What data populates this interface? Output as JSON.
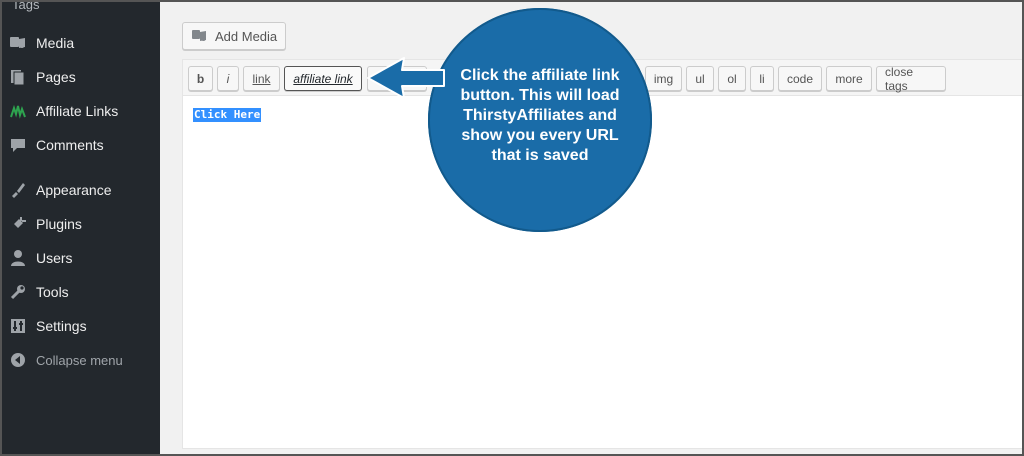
{
  "sidebar": {
    "top_label": "Tags",
    "items": [
      {
        "label": "Media",
        "icon": "media-icon"
      },
      {
        "label": "Pages",
        "icon": "pages-icon"
      },
      {
        "label": "Affiliate Links",
        "icon": "affiliate-links-icon"
      },
      {
        "label": "Comments",
        "icon": "comments-icon"
      },
      {
        "label": "Appearance",
        "icon": "appearance-icon"
      },
      {
        "label": "Plugins",
        "icon": "plugins-icon"
      },
      {
        "label": "Users",
        "icon": "users-icon"
      },
      {
        "label": "Tools",
        "icon": "tools-icon"
      },
      {
        "label": "Settings",
        "icon": "settings-icon"
      },
      {
        "label": "Collapse menu",
        "icon": "collapse-menu-icon"
      }
    ]
  },
  "editor": {
    "add_media_label": "Add Media",
    "toolbar_buttons": [
      "b",
      "i",
      "link",
      "affiliate link",
      "",
      "img",
      "ul",
      "ol",
      "li",
      "code",
      "more",
      "close tags"
    ],
    "selected_text": "Click Here"
  },
  "callout": {
    "text": "Click the affiliate link button. This will load ThirstyAffiliates and show you every URL that is saved"
  },
  "colors": {
    "sidebar_bg": "#23282d",
    "callout_blue": "#1a6ca8",
    "affiliate_icon_green": "#2ea44f",
    "selection_blue": "#3390ff"
  }
}
